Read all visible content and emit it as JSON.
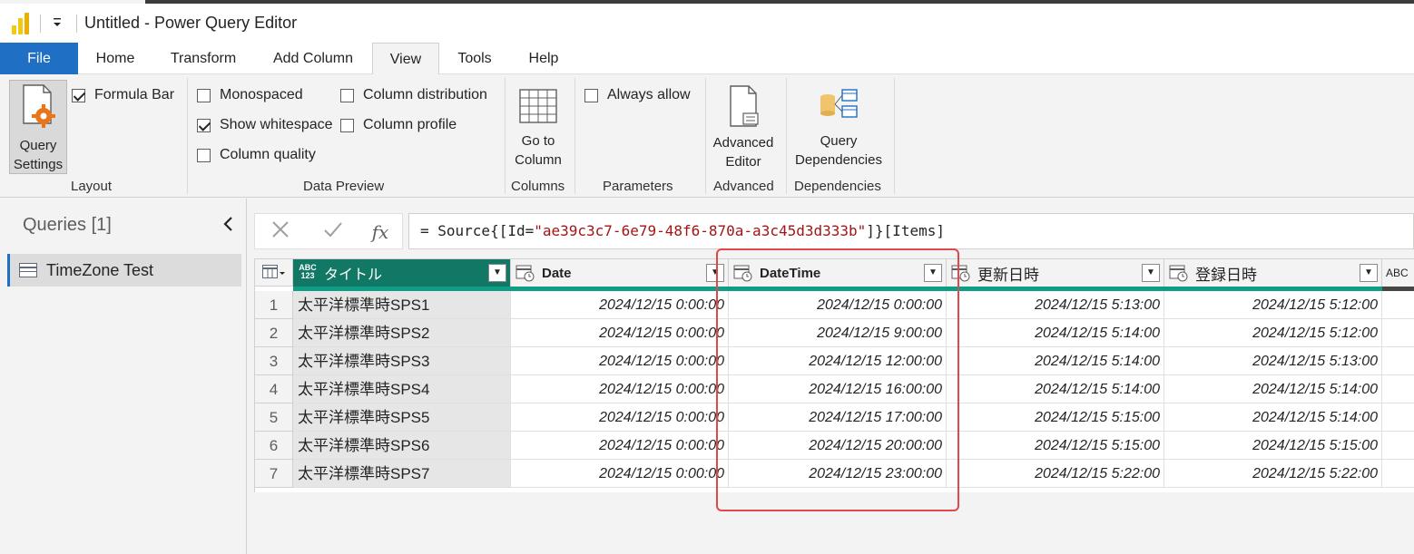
{
  "window": {
    "title": "Untitled - Power Query Editor"
  },
  "tabs": [
    {
      "label": "File"
    },
    {
      "label": "Home"
    },
    {
      "label": "Transform"
    },
    {
      "label": "Add Column"
    },
    {
      "label": "View"
    },
    {
      "label": "Tools"
    },
    {
      "label": "Help"
    }
  ],
  "ribbon": {
    "layout": {
      "query_settings": "Query\nSettings",
      "formula_bar": "Formula Bar",
      "formula_bar_checked": true,
      "group": "Layout"
    },
    "data_preview": {
      "monospaced": "Monospaced",
      "show_whitespace": "Show whitespace",
      "column_quality": "Column quality",
      "column_distribution": "Column distribution",
      "column_profile": "Column profile",
      "group": "Data Preview"
    },
    "columns": {
      "go_to_column": "Go to\nColumn",
      "group": "Columns"
    },
    "parameters": {
      "always_allow": "Always allow",
      "group": "Parameters"
    },
    "advanced": {
      "advanced_editor": "Advanced\nEditor",
      "group": "Advanced"
    },
    "dependencies": {
      "query_dependencies": "Query\nDependencies",
      "group": "Dependencies"
    }
  },
  "queries": {
    "title": "Queries [1]",
    "items": [
      {
        "name": "TimeZone Test"
      }
    ]
  },
  "formula": {
    "prefix": "= Source{[Id=",
    "string": "\"ae39c3c7-6e79-48f6-870a-a3c45d3d333b\"",
    "suffix": "]}[Items]"
  },
  "grid": {
    "columns": [
      {
        "name": "タイトル",
        "type": "ABC\n123"
      },
      {
        "name": "Date",
        "type": "date-time"
      },
      {
        "name": "DateTime",
        "type": "date-time"
      },
      {
        "name": "更新日時",
        "type": "date-time"
      },
      {
        "name": "登録日時",
        "type": "date-time"
      }
    ],
    "partial_column_type": "ABC",
    "rows": [
      {
        "n": "1",
        "title": "太平洋標準時SPS1",
        "date": "2024/12/15 0:00:00",
        "datetime": "2024/12/15 0:00:00",
        "modified": "2024/12/15 5:13:00",
        "created": "2024/12/15 5:12:00"
      },
      {
        "n": "2",
        "title": "太平洋標準時SPS2",
        "date": "2024/12/15 0:00:00",
        "datetime": "2024/12/15 9:00:00",
        "modified": "2024/12/15 5:14:00",
        "created": "2024/12/15 5:12:00"
      },
      {
        "n": "3",
        "title": "太平洋標準時SPS3",
        "date": "2024/12/15 0:00:00",
        "datetime": "2024/12/15 12:00:00",
        "modified": "2024/12/15 5:14:00",
        "created": "2024/12/15 5:13:00"
      },
      {
        "n": "4",
        "title": "太平洋標準時SPS4",
        "date": "2024/12/15 0:00:00",
        "datetime": "2024/12/15 16:00:00",
        "modified": "2024/12/15 5:14:00",
        "created": "2024/12/15 5:14:00"
      },
      {
        "n": "5",
        "title": "太平洋標準時SPS5",
        "date": "2024/12/15 0:00:00",
        "datetime": "2024/12/15 17:00:00",
        "modified": "2024/12/15 5:15:00",
        "created": "2024/12/15 5:14:00"
      },
      {
        "n": "6",
        "title": "太平洋標準時SPS6",
        "date": "2024/12/15 0:00:00",
        "datetime": "2024/12/15 20:00:00",
        "modified": "2024/12/15 5:15:00",
        "created": "2024/12/15 5:15:00"
      },
      {
        "n": "7",
        "title": "太平洋標準時SPS7",
        "date": "2024/12/15 0:00:00",
        "datetime": "2024/12/15 23:00:00",
        "modified": "2024/12/15 5:22:00",
        "created": "2024/12/15 5:22:00"
      }
    ]
  },
  "colors": {
    "file_tab": "#1f6fc5",
    "selected_column": "#117865",
    "quality_bar": "#0f9d85",
    "highlight": "#e0494b",
    "formula_string": "#a31515"
  },
  "icons": [
    "power-bi-logo",
    "dropdown-icon",
    "gear-icon",
    "table-icon",
    "close-icon",
    "check-icon",
    "fx-icon",
    "chevron-left-icon",
    "document-icon",
    "dependencies-icon",
    "calendar-clock-icon"
  ]
}
